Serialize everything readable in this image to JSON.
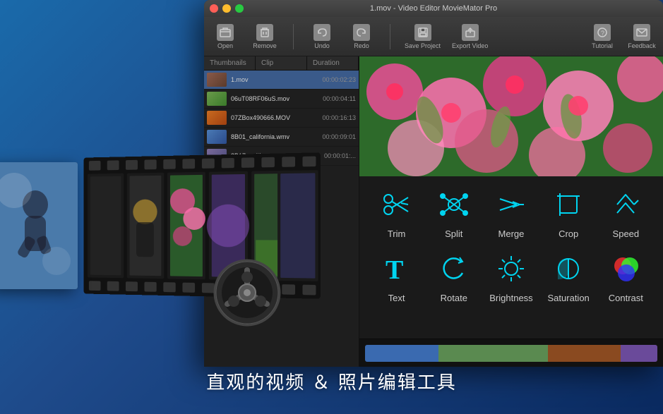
{
  "app": {
    "title": "1.mov - Video Editor MovieMator Pro",
    "window_controls": {
      "close": "●",
      "minimize": "●",
      "maximize": "●"
    }
  },
  "toolbar": {
    "buttons": [
      {
        "id": "open",
        "label": "Open",
        "icon": "📂"
      },
      {
        "id": "remove",
        "label": "Remove",
        "icon": "🗑"
      },
      {
        "id": "undo",
        "label": "Undo",
        "icon": "↩"
      },
      {
        "id": "redo",
        "label": "Redo",
        "icon": "↪"
      },
      {
        "id": "save",
        "label": "Save Project",
        "icon": "💾"
      },
      {
        "id": "export",
        "label": "Export Video",
        "icon": "📤"
      }
    ],
    "right_buttons": [
      {
        "id": "tutorial",
        "label": "Tutorial",
        "icon": "?"
      },
      {
        "id": "feedback",
        "label": "Feedback",
        "icon": "✉"
      }
    ]
  },
  "file_panel": {
    "headers": [
      "Thumbnails",
      "Clip",
      "Duration"
    ],
    "files": [
      {
        "name": "1.mov",
        "duration": "00:00:02:23",
        "thumb": "1"
      },
      {
        "name": "06uT08RF06uS.mov",
        "duration": "00:00:04:11",
        "thumb": "2"
      },
      {
        "name": "07ZBox490666.MOV",
        "duration": "00:00:16:13",
        "thumb": "3"
      },
      {
        "name": "8B01_california.wmv",
        "duration": "00:00:09:01",
        "thumb": "4"
      },
      {
        "name": "8B17_california.mov",
        "duration": "00:00:01:...",
        "thumb": "5"
      }
    ]
  },
  "tools": {
    "row1": [
      {
        "id": "trim",
        "label": "Trim",
        "icon_type": "trim"
      },
      {
        "id": "split",
        "label": "Split",
        "icon_type": "split"
      },
      {
        "id": "merge",
        "label": "Merge",
        "icon_type": "merge"
      },
      {
        "id": "crop",
        "label": "Crop",
        "icon_type": "crop"
      },
      {
        "id": "speed",
        "label": "Speed",
        "icon_type": "speed"
      }
    ],
    "row2": [
      {
        "id": "text",
        "label": "Text",
        "icon_type": "text"
      },
      {
        "id": "rotate",
        "label": "Rotate",
        "icon_type": "rotate"
      },
      {
        "id": "brightness",
        "label": "Brightness",
        "icon_type": "brightness"
      },
      {
        "id": "saturation",
        "label": "Saturation",
        "icon_type": "saturation"
      },
      {
        "id": "contrast",
        "label": "Contrast",
        "icon_type": "contrast"
      }
    ]
  },
  "film_strip": {
    "visible": true
  },
  "bottom_text": "直观的视频 ＆  照片编辑工具",
  "background": {
    "gradient_start": "#1a6aaa",
    "gradient_end": "#0a2a60"
  }
}
